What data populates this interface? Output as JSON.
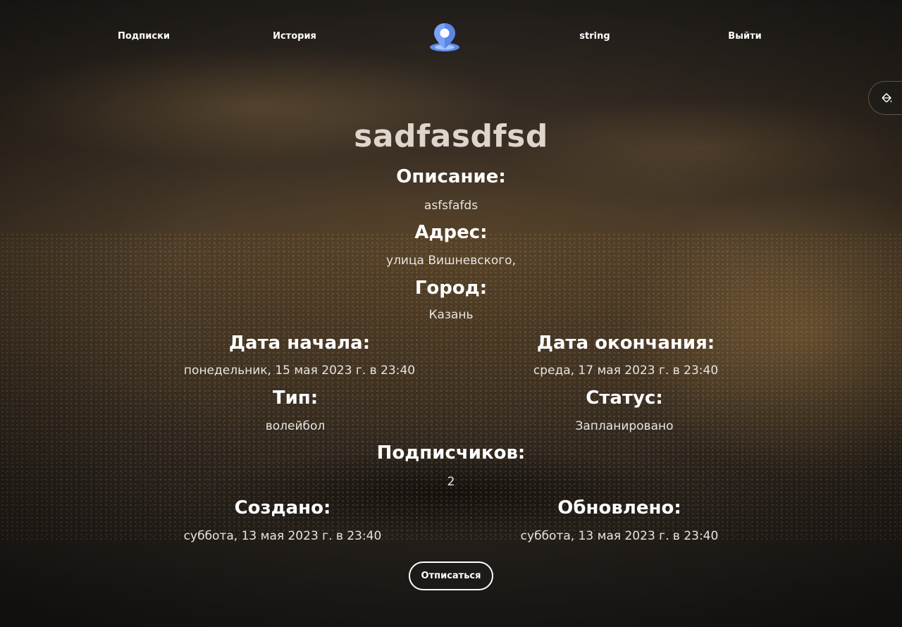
{
  "nav": {
    "subscriptions": "Подписки",
    "history": "История",
    "username": "string",
    "logout": "Выйти"
  },
  "event": {
    "title": "sadfasdfsd",
    "description_label": "Описание:",
    "description": "asfsfafds",
    "address_label": "Адрес:",
    "address": "улица Вишневского,",
    "city_label": "Город:",
    "city": "Казань",
    "start_label": "Дата начала:",
    "start": "понедельник, 15 мая 2023 г. в 23:40",
    "end_label": "Дата окончания:",
    "end": "среда, 17 мая 2023 г. в 23:40",
    "type_label": "Тип:",
    "type": "волейбол",
    "status_label": "Статус:",
    "status": "Запланировано",
    "subscribers_label": "Подписчиков:",
    "subscribers": "2",
    "created_label": "Создано:",
    "created": "суббота, 13 мая 2023 г. в 23:40",
    "updated_label": "Обновлено:",
    "updated": "суббота, 13 мая 2023 г. в 23:40"
  },
  "actions": {
    "unsubscribe": "Отписаться"
  },
  "icons": {
    "logo": "map-pin-icon",
    "theme": "paint-bucket-icon"
  },
  "colors": {
    "logo_pin": "#6f9bf2",
    "title": "#ded5cd",
    "text": "#ffffff"
  }
}
